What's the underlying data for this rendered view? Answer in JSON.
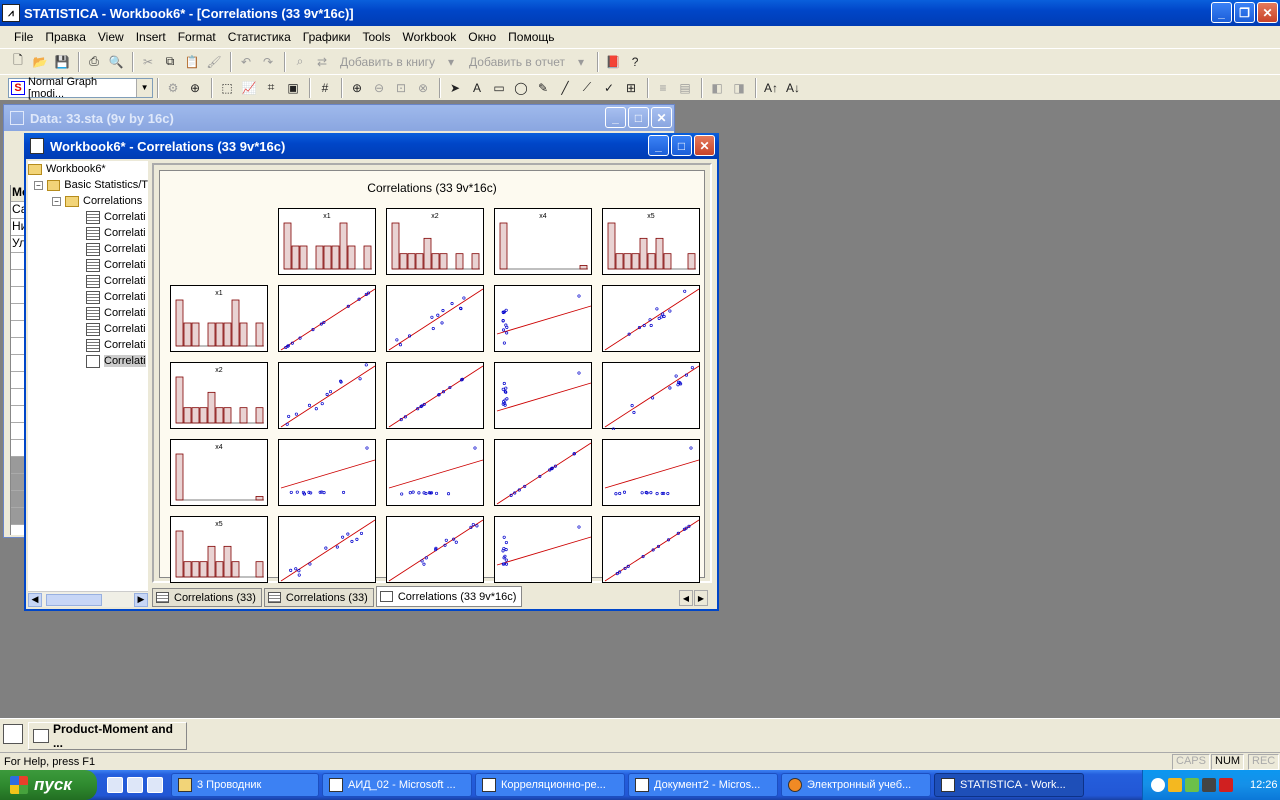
{
  "app": {
    "title": "STATISTICA - Workbook6* - [Correlations (33 9v*16c)]"
  },
  "menu": [
    "File",
    "Правка",
    "View",
    "Insert",
    "Format",
    "Статистика",
    "Графики",
    "Tools",
    "Workbook",
    "Окно",
    "Помощь"
  ],
  "toolbar1": {
    "add_to_book": "Добавить в книгу",
    "add_to_report": "Добавить в отчет"
  },
  "toolbar2": {
    "graph_type": "Normal Graph [modi..."
  },
  "data_window": {
    "title": "Data: 33.sta (9v by 16c)",
    "row_labels": [
      "Ме",
      "Са",
      "Ни",
      "Ул"
    ]
  },
  "workbook_window": {
    "title": "Workbook6* - Correlations (33 9v*16c)",
    "tree": {
      "root": "Workbook6*",
      "group": "Basic Statistics/T",
      "folder": "Correlations",
      "items": [
        "Correlati",
        "Correlati",
        "Correlati",
        "Correlati",
        "Correlati",
        "Correlati",
        "Correlati",
        "Correlati",
        "Correlati",
        "Correlati"
      ]
    },
    "tabs": [
      "Correlations (33)",
      "Correlations (33)",
      "Correlations (33 9v*16c)"
    ]
  },
  "chart_data": {
    "type": "scatter",
    "title": "Correlations (33 9v*16c)",
    "variables": [
      "x1",
      "x2",
      "x4",
      "x5"
    ],
    "histograms": {
      "x1": [
        2,
        1,
        1,
        0,
        1,
        1,
        1,
        2,
        1,
        0,
        1
      ],
      "x2": [
        3,
        1,
        1,
        1,
        2,
        1,
        1,
        0,
        1,
        0,
        1
      ],
      "x4": [
        13,
        0,
        0,
        0,
        0,
        0,
        0,
        0,
        0,
        0,
        1
      ],
      "x5": [
        3,
        1,
        1,
        1,
        2,
        1,
        2,
        1,
        0,
        0,
        1
      ]
    },
    "grid": false
  },
  "minimized": {
    "label": "Product-Moment and ..."
  },
  "status": {
    "help": "For Help, press F1",
    "caps": "CAPS",
    "num": "NUM",
    "rec": "REC"
  },
  "taskbar": {
    "start": "пуск",
    "buttons": [
      "3 Проводник",
      "АИД_02 - Microsoft ...",
      "Корреляционно-ре...",
      "Документ2 - Micros...",
      "Электронный учеб...",
      "STATISTICA - Work..."
    ],
    "clock": "12:26"
  },
  "colors": {
    "titlebar": "#0046c8",
    "fit_line": "#cc0000",
    "points": "#0000cc",
    "hist_fill": "#c08080"
  }
}
